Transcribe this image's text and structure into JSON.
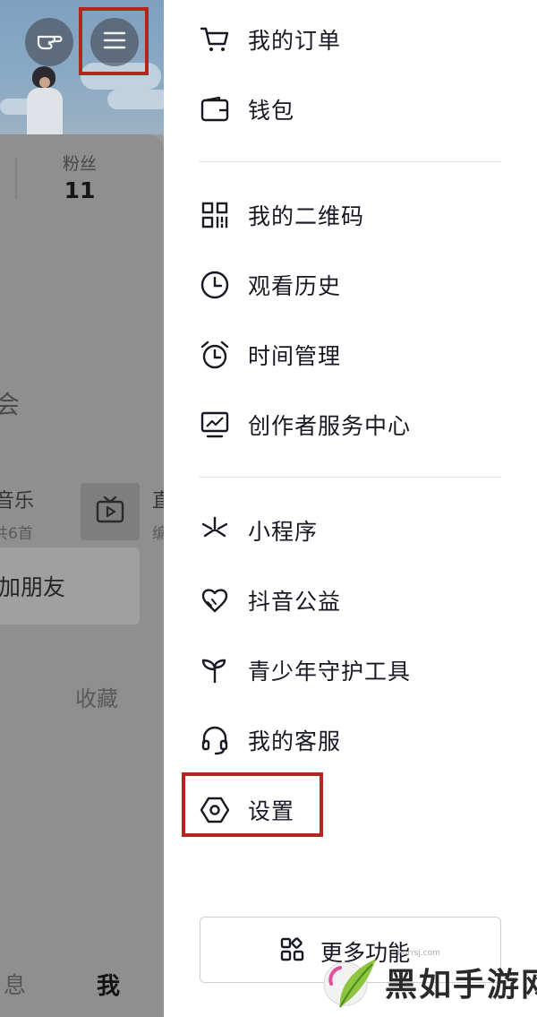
{
  "profile": {
    "stat_label": "粉丝",
    "stat_value": "11",
    "edge_glyph": "会",
    "music_label": "音乐",
    "music_sub": "共6首",
    "live_label": "直",
    "live_sub": "编",
    "add_friend_label": "加朋友",
    "favorites_tab": "收藏",
    "nav_messages": "息",
    "nav_me": "我"
  },
  "drawer": {
    "items": [
      {
        "label": "我的订单",
        "icon": "cart-icon"
      },
      {
        "label": "钱包",
        "icon": "wallet-icon"
      },
      {
        "label": "我的二维码",
        "icon": "qr-code-icon"
      },
      {
        "label": "观看历史",
        "icon": "clock-icon"
      },
      {
        "label": "时间管理",
        "icon": "alarm-clock-icon"
      },
      {
        "label": "创作者服务中心",
        "icon": "monitor-chart-icon"
      },
      {
        "label": "小程序",
        "icon": "asterisk-icon"
      },
      {
        "label": "抖音公益",
        "icon": "heart-hands-icon"
      },
      {
        "label": "青少年守护工具",
        "icon": "sprout-icon"
      },
      {
        "label": "我的客服",
        "icon": "headset-icon"
      },
      {
        "label": "设置",
        "icon": "hexagon-gear-icon"
      }
    ],
    "more_button": "更多功能"
  },
  "watermark": {
    "brand": "黑如手游网",
    "url": "hnrrsj.com"
  },
  "colors": {
    "highlight_box": "#b3261e",
    "overlay_gray": "#8f8f8f"
  }
}
